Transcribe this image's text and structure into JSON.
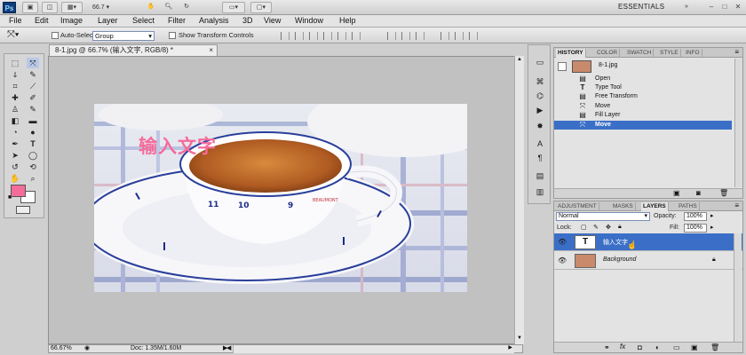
{
  "app": {
    "logo": "Ps",
    "zoom_level": "66.7",
    "workspace": "ESSENTIALS",
    "window_min": "–",
    "window_max": "□",
    "window_close": "✕"
  },
  "menu": [
    {
      "label": "File"
    },
    {
      "label": "Edit"
    },
    {
      "label": "Image"
    },
    {
      "label": "Layer"
    },
    {
      "label": "Select"
    },
    {
      "label": "Filter"
    },
    {
      "label": "Analysis"
    },
    {
      "label": "3D"
    },
    {
      "label": "View"
    },
    {
      "label": "Window"
    },
    {
      "label": "Help"
    }
  ],
  "options_bar": {
    "auto_select_label": "Auto-Select:",
    "auto_select_value": "Group",
    "show_transform_label": "Show Transform Controls"
  },
  "document": {
    "tab_title": "8-1.jpg @ 66.7% (输入文字, RGB/8) *",
    "tab_close": "×",
    "overlay_text": "输入文字",
    "zoom_status": "66.67%",
    "doc_status": "Doc: 1.35M/1.60M",
    "cup_digits": [
      "11",
      "10",
      "9"
    ],
    "cup_brand": "BEAUMONT"
  },
  "history_panel": {
    "tabs": [
      "HISTORY",
      "COLOR",
      "SWATCH",
      "STYLE",
      "INFO"
    ],
    "snapshot_name": "8-1.jpg",
    "rows": [
      {
        "label": "Open",
        "icon": "document-icon"
      },
      {
        "label": "Type Tool",
        "icon": "type-icon"
      },
      {
        "label": "Free Transform",
        "icon": "document-icon"
      },
      {
        "label": "Move",
        "icon": "move-icon"
      },
      {
        "label": "Fill Layer",
        "icon": "document-icon"
      },
      {
        "label": "Move",
        "icon": "move-icon"
      }
    ]
  },
  "layers_panel": {
    "tabs": [
      "ADJUSTMENT",
      "MASKS",
      "LAYERS",
      "PATHS"
    ],
    "blend_mode": "Normal",
    "opacity_label": "Opacity:",
    "opacity_value": "100%",
    "lock_label": "Lock:",
    "fill_label": "Fill:",
    "fill_value": "100%",
    "layers": [
      {
        "name": "输入文字",
        "thumb": "T",
        "selected": true
      },
      {
        "name": "Background",
        "selected": false
      }
    ]
  },
  "colors": {
    "foreground": "#f46c9a",
    "background": "#ffffff",
    "selection": "#3b6fc7",
    "text_overlay": "#f46c9a"
  }
}
